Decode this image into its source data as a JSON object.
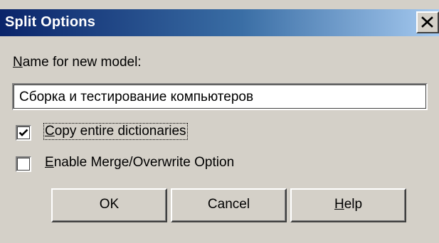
{
  "window": {
    "title": "Split Options",
    "close_icon": "close-x-icon"
  },
  "name_field": {
    "label_mnemonic": "N",
    "label_rest": "ame for new model:",
    "value": "Сборка и тестирование компьютеров"
  },
  "options": [
    {
      "mnemonic": "C",
      "label_rest": "opy entire dictionaries",
      "checked": true
    },
    {
      "mnemonic": "E",
      "label_rest": "nable Merge/Overwrite Option",
      "checked": false
    }
  ],
  "buttons": {
    "ok_label": "OK",
    "cancel_label": "Cancel",
    "help_mnemonic": "H",
    "help_rest": "elp"
  }
}
